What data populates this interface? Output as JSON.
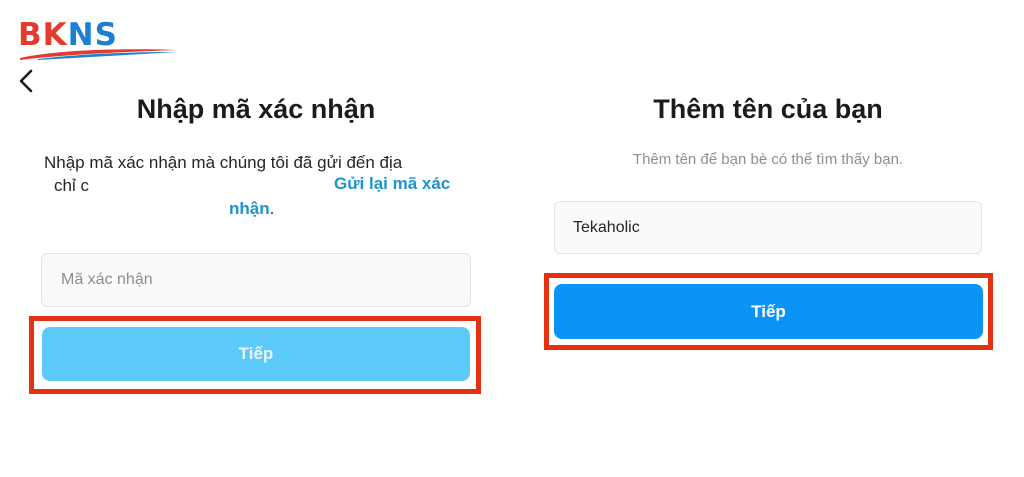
{
  "logo": {
    "brand": "BKNS",
    "brand_red": "BK",
    "brand_blue": "NS",
    "red": "#e53a2e",
    "blue": "#1d7fd1"
  },
  "nav": {
    "back_icon": "chevron-left-icon"
  },
  "left_screen": {
    "title": "Nhập mã xác nhận",
    "description_line1": "Nhập mã xác nhận mà chúng tôi đã gửi đến địa",
    "description_line2_start": "chỉ c",
    "resend_link_part1": "Gửi lại mã xác",
    "resend_link_part2": "nhận",
    "resend_suffix": ".",
    "code_input": {
      "placeholder": "Mã xác nhận",
      "value": ""
    },
    "next_button": "Tiếp",
    "button_color": "#5ccaf9"
  },
  "right_screen": {
    "title": "Thêm tên của bạn",
    "description": "Thêm tên để bạn bè có thể tìm thấy bạn.",
    "name_input": {
      "value": "Tekaholic"
    },
    "next_button": "Tiếp",
    "button_color": "#0a95f6"
  },
  "highlight_color": "#e2320f"
}
